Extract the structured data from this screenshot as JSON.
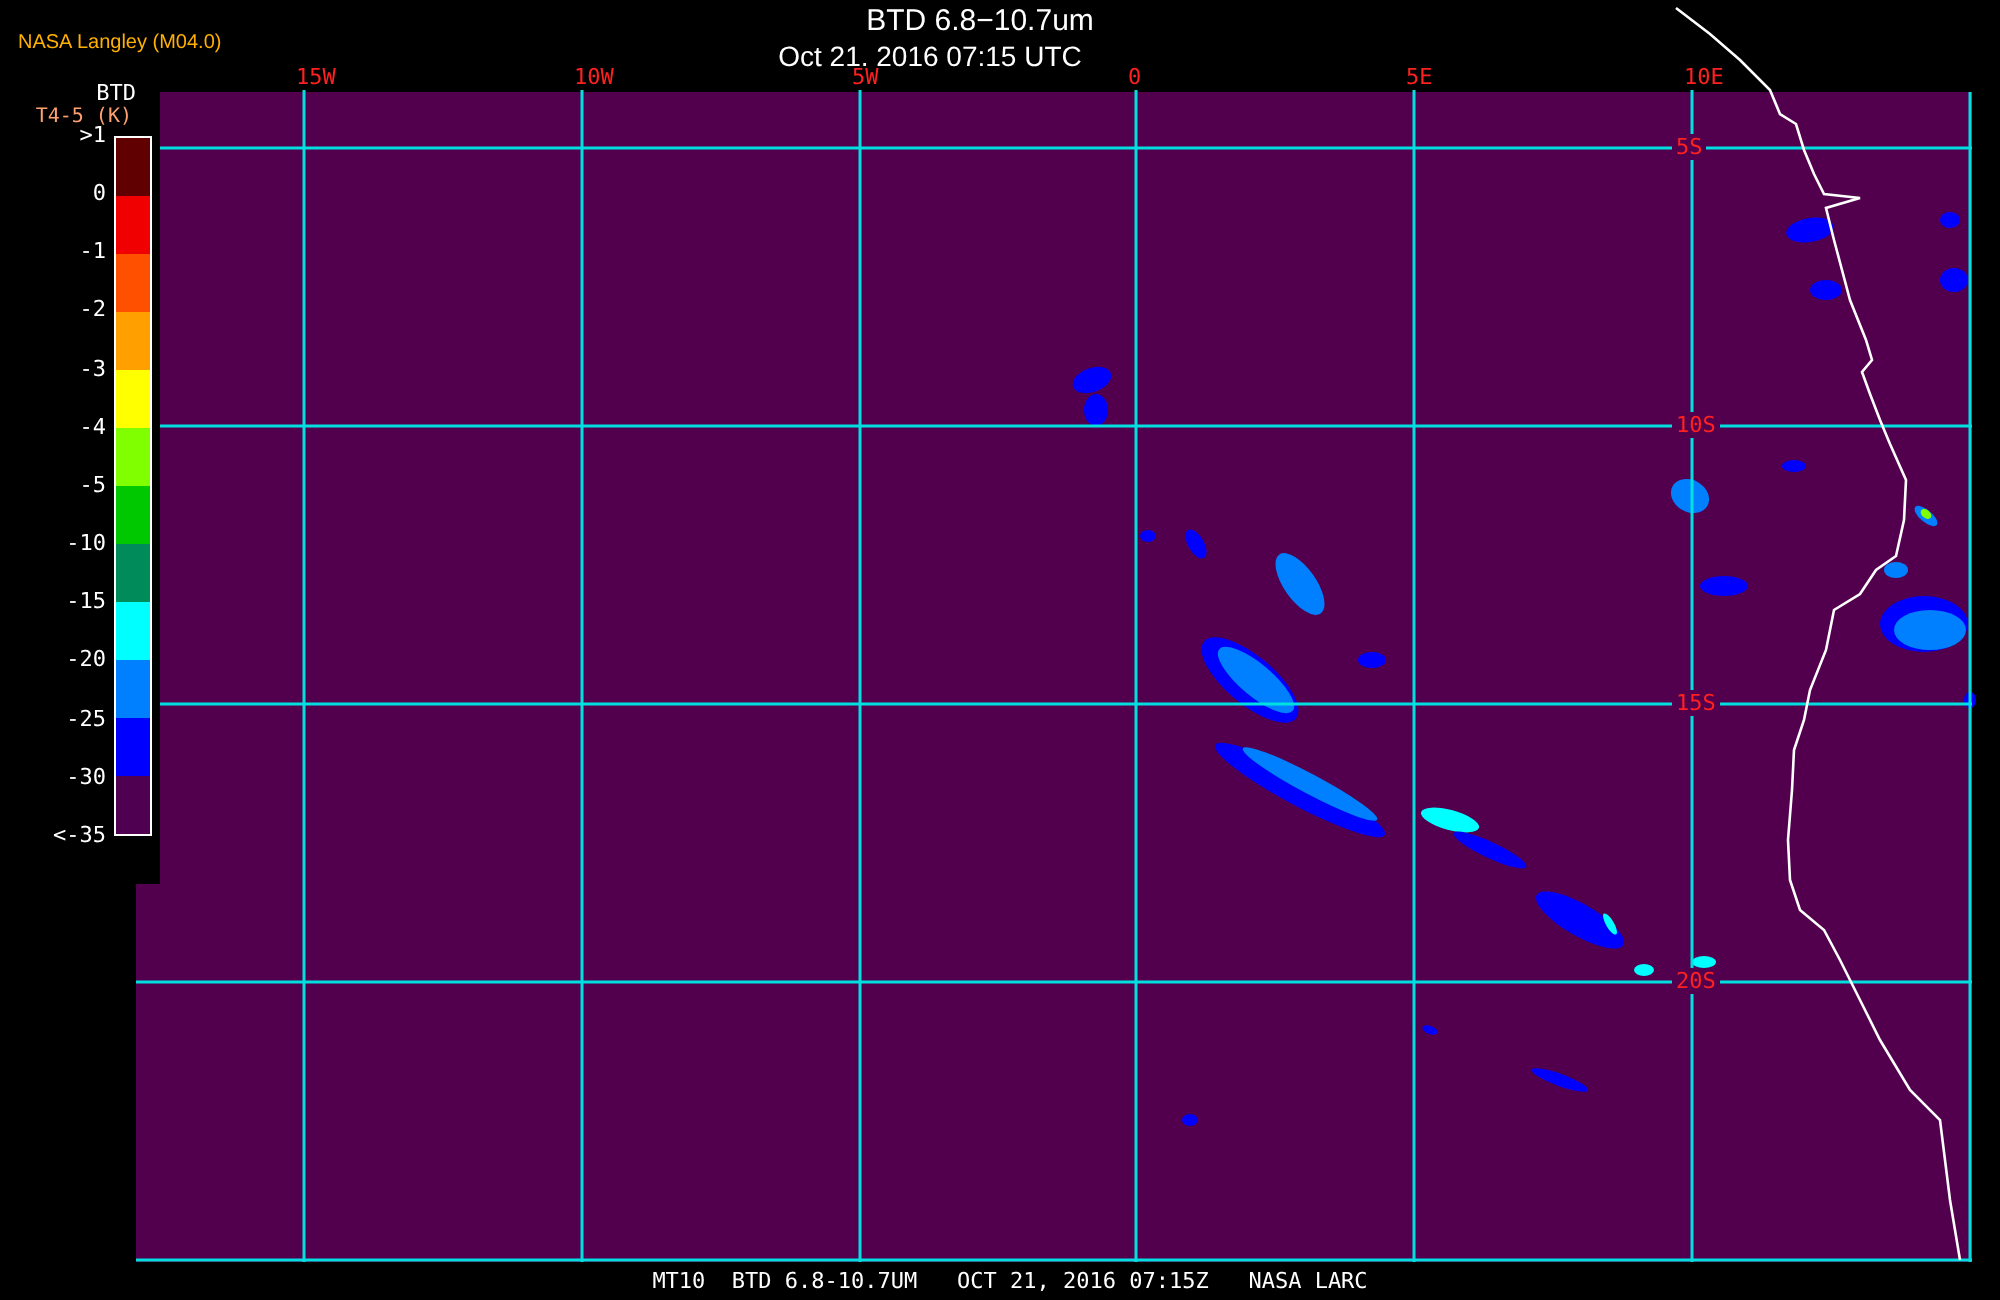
{
  "credit": "NASA Langley (M04.0)",
  "title": "BTD 6.8−10.7um",
  "subtitle": "Oct 21, 2016 07:15 UTC",
  "legend": {
    "title": "BTD",
    "unit": "T4-5 (K)",
    "ticks": [
      ">1",
      "0",
      "-1",
      "-2",
      "-3",
      "-4",
      "-5",
      "-10",
      "-15",
      "-20",
      "-25",
      "-30",
      "<-35"
    ],
    "bands": [
      {
        "color": "#600000"
      },
      {
        "color": "#f00000"
      },
      {
        "color": "#ff5000"
      },
      {
        "color": "#ffa000"
      },
      {
        "color": "#ffff00"
      },
      {
        "color": "#80ff00"
      },
      {
        "color": "#00c800"
      },
      {
        "color": "#008c5a"
      },
      {
        "color": "#00ffff"
      },
      {
        "color": "#0080ff"
      },
      {
        "color": "#0000ff"
      },
      {
        "color": "#500050"
      }
    ]
  },
  "map": {
    "longitude_labels": [
      "15W",
      "10W",
      "5W",
      "0",
      "5E",
      "10E"
    ],
    "latitude_labels": [
      "5S",
      "10S",
      "15S",
      "20S"
    ]
  },
  "footer": "MT10  BTD 6.8-10.7UM   OCT 21, 2016 07:15Z   NASA LARC"
}
